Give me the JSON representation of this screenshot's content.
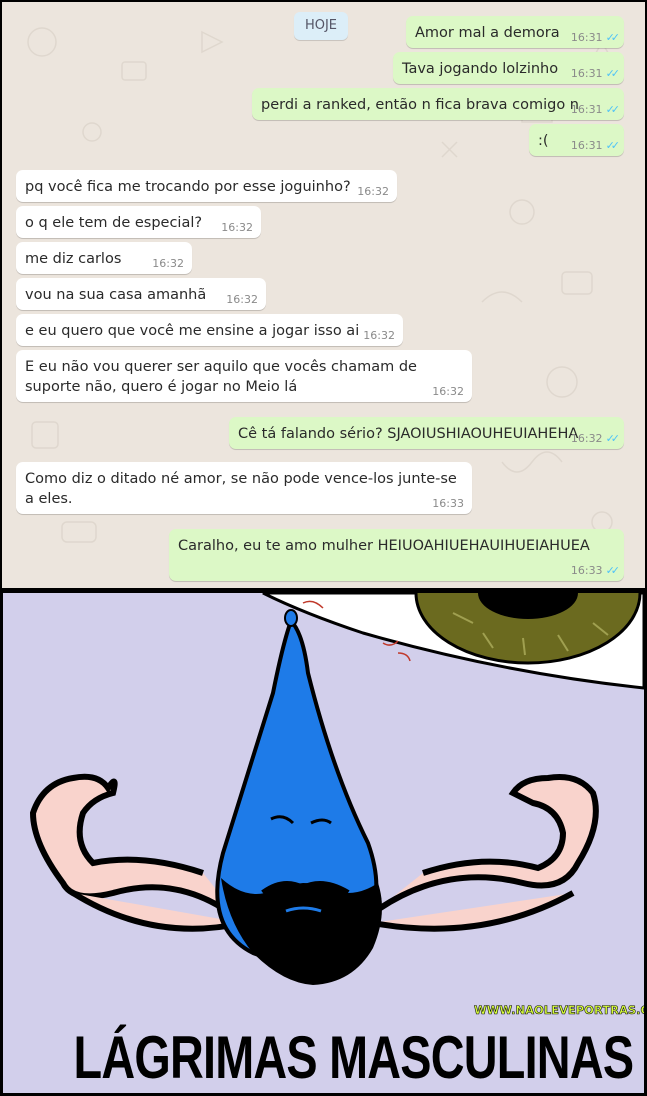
{
  "date_label": "HOJE",
  "messages": [
    {
      "dir": "out",
      "text": "Amor mal a demora",
      "time": "16:31"
    },
    {
      "dir": "out",
      "text": "Tava jogando lolzinho",
      "time": "16:31"
    },
    {
      "dir": "out",
      "text": "perdi a ranked, então n fica brava comigo n",
      "time": "16:31"
    },
    {
      "dir": "out",
      "text": ":(",
      "time": "16:31"
    },
    {
      "dir": "in",
      "text": "pq você fica me trocando por esse joguinho?",
      "time": "16:32"
    },
    {
      "dir": "in",
      "text": "o q ele tem de especial?",
      "time": "16:32"
    },
    {
      "dir": "in",
      "text": "me diz carlos",
      "time": "16:32"
    },
    {
      "dir": "in",
      "text": "vou na sua casa amanhã",
      "time": "16:32"
    },
    {
      "dir": "in",
      "text": "e eu quero que você me ensine a jogar isso ai",
      "time": "16:32"
    },
    {
      "dir": "in",
      "text": "E eu não vou querer ser aquilo que vocês chamam de suporte não, quero é jogar no Meio lá",
      "time": "16:32"
    },
    {
      "dir": "out",
      "text": "Cê tá falando sério? SJAOIUSHIAOUHEUIAHEHA",
      "time": "16:32"
    },
    {
      "dir": "in",
      "text": "Como diz o ditado né amor, se não pode vence-los junte-se a eles.",
      "time": "16:33"
    },
    {
      "dir": "out",
      "text": "Caralho, eu te amo mulher HEIUOAHIUEHAUIHUEIAHUEA",
      "time": "16:33"
    }
  ],
  "comic": {
    "watermark": "WWW.NAOLEVEPORTRAS.COM",
    "caption": "LÁGRIMAS MASCULINAS"
  },
  "colors": {
    "chat_bg": "#ece5dd",
    "bubble_in": "#ffffff",
    "bubble_out": "#dcf8c6",
    "read_ticks": "#4fc3f7",
    "comic_bg": "#d2cfeb",
    "tear": "#1e7be8",
    "iris": "#6b6a1f",
    "skin": "#f9d3cc",
    "beard": "#000000"
  },
  "icons": {
    "read_receipt": "double-check-icon"
  }
}
